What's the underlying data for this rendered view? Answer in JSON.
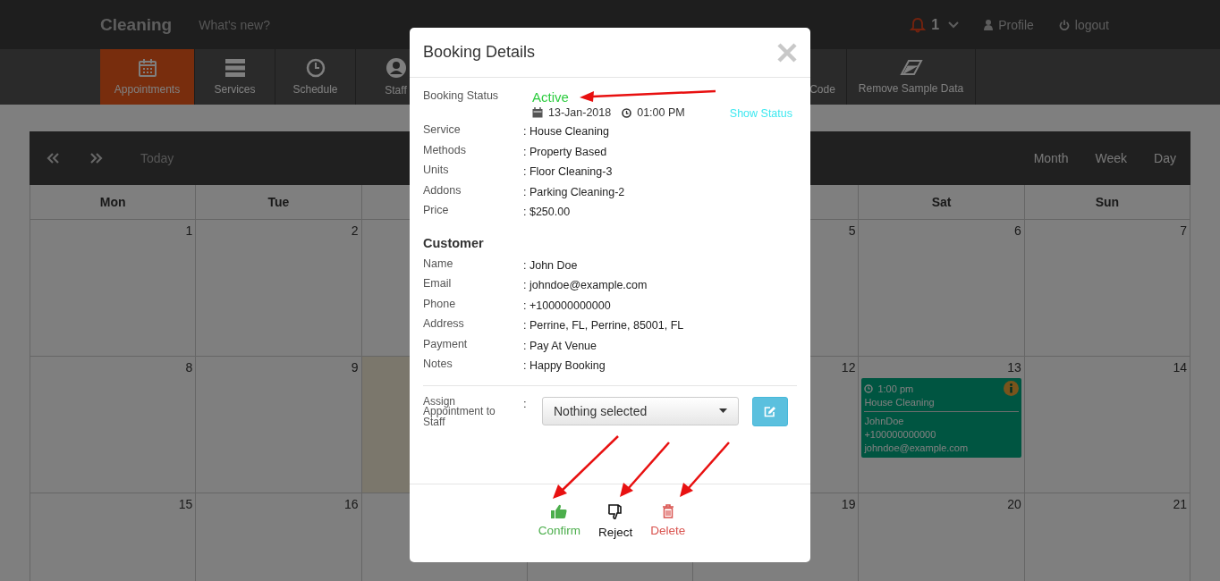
{
  "topbar": {
    "brand": "Cleaning",
    "whats_new": "What's new?",
    "notification_count": "1",
    "profile": "Profile",
    "logout": "logout"
  },
  "nav": [
    {
      "kind": "calendar",
      "label": "Appointments",
      "selected": true
    },
    {
      "kind": "server",
      "label": "Services",
      "selected": false
    },
    {
      "kind": "clock",
      "label": "Schedule",
      "selected": false
    },
    {
      "kind": "user",
      "label": "Staff",
      "selected": false
    },
    {
      "kind": "none",
      "label": "Code",
      "selected": false
    },
    {
      "kind": "eraser",
      "label": "Remove Sample Data",
      "selected": false
    }
  ],
  "calendar": {
    "today_button": "Today",
    "views": [
      "Month",
      "Week",
      "Day"
    ],
    "weekdays": [
      "Mon",
      "Tue",
      "Sat",
      "Sun"
    ],
    "weeks": [
      {
        "days": [
          {
            "date": "1",
            "today": false
          },
          {
            "date": "2",
            "today": false
          },
          {
            "date": "5",
            "today": false
          },
          {
            "date": "6",
            "today": false
          },
          {
            "date": "7",
            "today": false
          }
        ]
      },
      {
        "days": [
          {
            "date": "8",
            "today": false
          },
          {
            "date": "9",
            "today": false
          },
          {
            "today": true
          },
          {
            "date": "12",
            "today": false
          },
          {
            "date": "13",
            "today": false,
            "event": {
              "time": "1:00 pm",
              "title": "House Cleaning",
              "customer": "JohnDoe",
              "phone": "+100000000000",
              "email": "johndoe@example.com"
            }
          },
          {
            "date": "14",
            "today": false
          }
        ]
      },
      {
        "days": [
          {
            "date": "15",
            "today": false
          },
          {
            "date": "16",
            "today": false
          },
          {
            "date": "19",
            "today": false
          },
          {
            "date": "20",
            "today": false
          },
          {
            "date": "21",
            "today": false
          }
        ]
      }
    ]
  },
  "modal": {
    "title": "Booking Details",
    "status": {
      "label": "Booking Status",
      "value": "Active",
      "date": "13-Jan-2018",
      "time": "01:00 PM",
      "link": "Show Status"
    },
    "booking": [
      {
        "label": "Service",
        "value": ": House Cleaning"
      },
      {
        "label": "Methods",
        "value": ": Property Based"
      },
      {
        "label": "Units",
        "value": ": Floor Cleaning-3"
      },
      {
        "label": "Addons",
        "value": ": Parking Cleaning-2"
      },
      {
        "label": "Price",
        "value": ": $250.00"
      }
    ],
    "customer_heading": "Customer",
    "customer": [
      {
        "label": "Name",
        "value": ": John Doe"
      },
      {
        "label": "Email",
        "value": ": johndoe@example.com"
      },
      {
        "label": "Phone",
        "value": ": +100000000000"
      },
      {
        "label": "Address",
        "value": ": Perrine, FL, Perrine, 85001, FL"
      },
      {
        "label": "Payment",
        "value": ": Pay At Venue"
      },
      {
        "label": "Notes",
        "value": ": Happy Booking"
      }
    ],
    "assign": {
      "label": "Assign Appointment to Staff",
      "colon": ":",
      "placeholder": "Nothing selected"
    },
    "actions": [
      {
        "kind": "confirm",
        "label": "Confirm"
      },
      {
        "kind": "reject",
        "label": "Reject"
      },
      {
        "kind": "delete",
        "label": "Delete"
      }
    ]
  }
}
